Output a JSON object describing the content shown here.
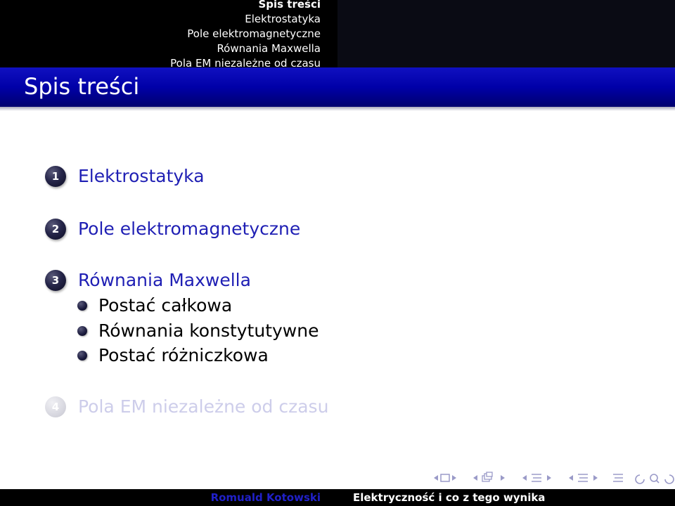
{
  "header": {
    "nav": [
      {
        "label": "Spis treści",
        "active": true
      },
      {
        "label": "Elektrostatyka",
        "active": false
      },
      {
        "label": "Pole elektromagnetyczne",
        "active": false
      },
      {
        "label": "Równania Maxwella",
        "active": false
      },
      {
        "label": "Pola EM niezależne od czasu",
        "active": false
      }
    ]
  },
  "frame": {
    "title": "Spis treści"
  },
  "toc": {
    "sections": [
      {
        "number": "1",
        "label": "Elektrostatyka"
      },
      {
        "number": "2",
        "label": "Pole elektromagnetyczne"
      },
      {
        "number": "3",
        "label": "Równania Maxwella",
        "subsections": [
          "Postać całkowa",
          "Równania konstytutywne",
          "Postać różniczkowa"
        ]
      },
      {
        "number": "4",
        "label": "Pola EM niezależne od czasu"
      }
    ]
  },
  "footer": {
    "author": "Romuald Kotowski",
    "title": "Elektryczność i co z tego wynika"
  },
  "colors": {
    "structure": "#1f1fb4",
    "titlebar": "#0000a8",
    "shaded": "#cdcdea",
    "band": "#000000"
  },
  "icons": [
    "nav-frame-icon",
    "nav-subsection-icon",
    "nav-section-icon",
    "nav-presentation-icon",
    "nav-zoom-icon"
  ]
}
